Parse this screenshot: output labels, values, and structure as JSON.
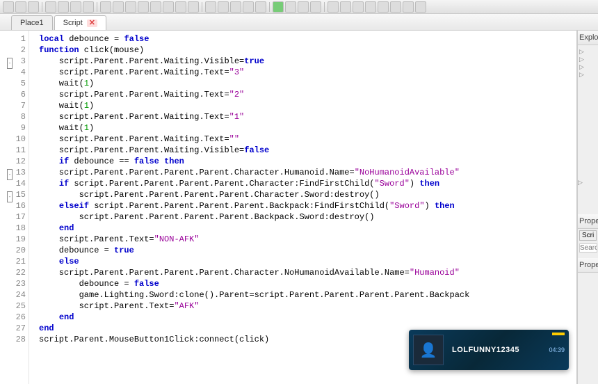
{
  "tabs": [
    {
      "label": "Place1",
      "active": false
    },
    {
      "label": "Script",
      "active": true,
      "closable": true
    }
  ],
  "rightPanel": {
    "explorerLabel": "Explo",
    "propertiesLabel": "Prope",
    "scriptBtn": "Scri",
    "searchPlaceholder": "Searc"
  },
  "notification": {
    "username": "LOLFUNNY12345",
    "time": "04:39"
  },
  "code": {
    "lines": [
      {
        "n": 1,
        "tokens": [
          [
            "kw",
            "local"
          ],
          [
            " debounce = "
          ],
          [
            "bool",
            "false"
          ]
        ]
      },
      {
        "n": 2,
        "fold": true,
        "tokens": [
          [
            "kw",
            "function"
          ],
          [
            " click(mouse)"
          ]
        ]
      },
      {
        "n": 3,
        "tokens": [
          [
            "",
            "    script.Parent.Parent.Waiting.Visible="
          ],
          [
            "bool",
            "true"
          ]
        ]
      },
      {
        "n": 4,
        "tokens": [
          [
            "",
            "    script.Parent.Parent.Waiting.Text="
          ],
          [
            "str",
            "\"3\""
          ]
        ]
      },
      {
        "n": 5,
        "tokens": [
          [
            "",
            "    wait("
          ],
          [
            "num",
            "1"
          ],
          [
            "",
            ")"
          ]
        ]
      },
      {
        "n": 6,
        "tokens": [
          [
            "",
            "    script.Parent.Parent.Waiting.Text="
          ],
          [
            "str",
            "\"2\""
          ]
        ]
      },
      {
        "n": 7,
        "tokens": [
          [
            "",
            "    wait("
          ],
          [
            "num",
            "1"
          ],
          [
            "",
            ")"
          ]
        ]
      },
      {
        "n": 8,
        "tokens": [
          [
            "",
            "    script.Parent.Parent.Waiting.Text="
          ],
          [
            "str",
            "\"1\""
          ]
        ]
      },
      {
        "n": 9,
        "tokens": [
          [
            "",
            "    wait("
          ],
          [
            "num",
            "1"
          ],
          [
            "",
            ")"
          ]
        ]
      },
      {
        "n": 10,
        "tokens": [
          [
            "",
            "    script.Parent.Parent.Waiting.Text="
          ],
          [
            "str",
            "\"\""
          ]
        ]
      },
      {
        "n": 11,
        "tokens": [
          [
            "",
            "    script.Parent.Parent.Waiting.Visible="
          ],
          [
            "bool",
            "false"
          ]
        ]
      },
      {
        "n": 12,
        "fold": true,
        "tokens": [
          [
            "",
            "    "
          ],
          [
            "kw",
            "if"
          ],
          [
            " debounce == "
          ],
          [
            "bool",
            "false"
          ],
          [
            " "
          ],
          [
            "kw",
            "then"
          ]
        ]
      },
      {
        "n": 13,
        "tokens": [
          [
            "",
            "    script.Parent.Parent.Parent.Parent.Character.Humanoid.Name="
          ],
          [
            "str",
            "\"NoHumanoidAvailable\""
          ]
        ]
      },
      {
        "n": 14,
        "fold": true,
        "tokens": [
          [
            "",
            "    "
          ],
          [
            "kw",
            "if"
          ],
          [
            " script.Parent.Parent.Parent.Parent.Character:FindFirstChild("
          ],
          [
            "str",
            "\"Sword\""
          ],
          [
            "",
            ") "
          ],
          [
            "kw",
            "then"
          ]
        ]
      },
      {
        "n": 15,
        "tokens": [
          [
            "",
            "        script.Parent.Parent.Parent.Parent.Character.Sword:destroy()"
          ]
        ]
      },
      {
        "n": 16,
        "tokens": [
          [
            "",
            "    "
          ],
          [
            "kw",
            "elseif"
          ],
          [
            " script.Parent.Parent.Parent.Parent.Backpack:FindFirstChild("
          ],
          [
            "str",
            "\"Sword\""
          ],
          [
            "",
            ") "
          ],
          [
            "kw",
            "then"
          ]
        ]
      },
      {
        "n": 17,
        "tokens": [
          [
            "",
            "        script.Parent.Parent.Parent.Parent.Backpack.Sword:destroy()"
          ]
        ]
      },
      {
        "n": 18,
        "tokens": [
          [
            "",
            "    "
          ],
          [
            "kw",
            "end"
          ]
        ]
      },
      {
        "n": 19,
        "tokens": [
          [
            "",
            "    script.Parent.Text="
          ],
          [
            "str",
            "\"NON-AFK\""
          ]
        ]
      },
      {
        "n": 20,
        "tokens": [
          [
            "",
            "    debounce = "
          ],
          [
            "bool",
            "true"
          ]
        ]
      },
      {
        "n": 21,
        "tokens": [
          [
            "",
            "    "
          ],
          [
            "kw",
            "else"
          ]
        ]
      },
      {
        "n": 22,
        "tokens": [
          [
            "",
            "    script.Parent.Parent.Parent.Parent.Character.NoHumanoidAvailable.Name="
          ],
          [
            "str",
            "\"Humanoid\""
          ]
        ]
      },
      {
        "n": 23,
        "tokens": [
          [
            "",
            "        debounce = "
          ],
          [
            "bool",
            "false"
          ]
        ]
      },
      {
        "n": 24,
        "tokens": [
          [
            "",
            "        game.Lighting.Sword:clone().Parent=script.Parent.Parent.Parent.Parent.Backpack"
          ]
        ]
      },
      {
        "n": 25,
        "tokens": [
          [
            "",
            "        script.Parent.Text="
          ],
          [
            "str",
            "\"AFK\""
          ]
        ]
      },
      {
        "n": 26,
        "tokens": [
          [
            "",
            "    "
          ],
          [
            "kw",
            "end"
          ]
        ]
      },
      {
        "n": 27,
        "tokens": [
          [
            "kw",
            "end"
          ]
        ]
      },
      {
        "n": 28,
        "tokens": [
          [
            "",
            "script.Parent.MouseButton1Click:connect(click)"
          ]
        ]
      }
    ]
  }
}
